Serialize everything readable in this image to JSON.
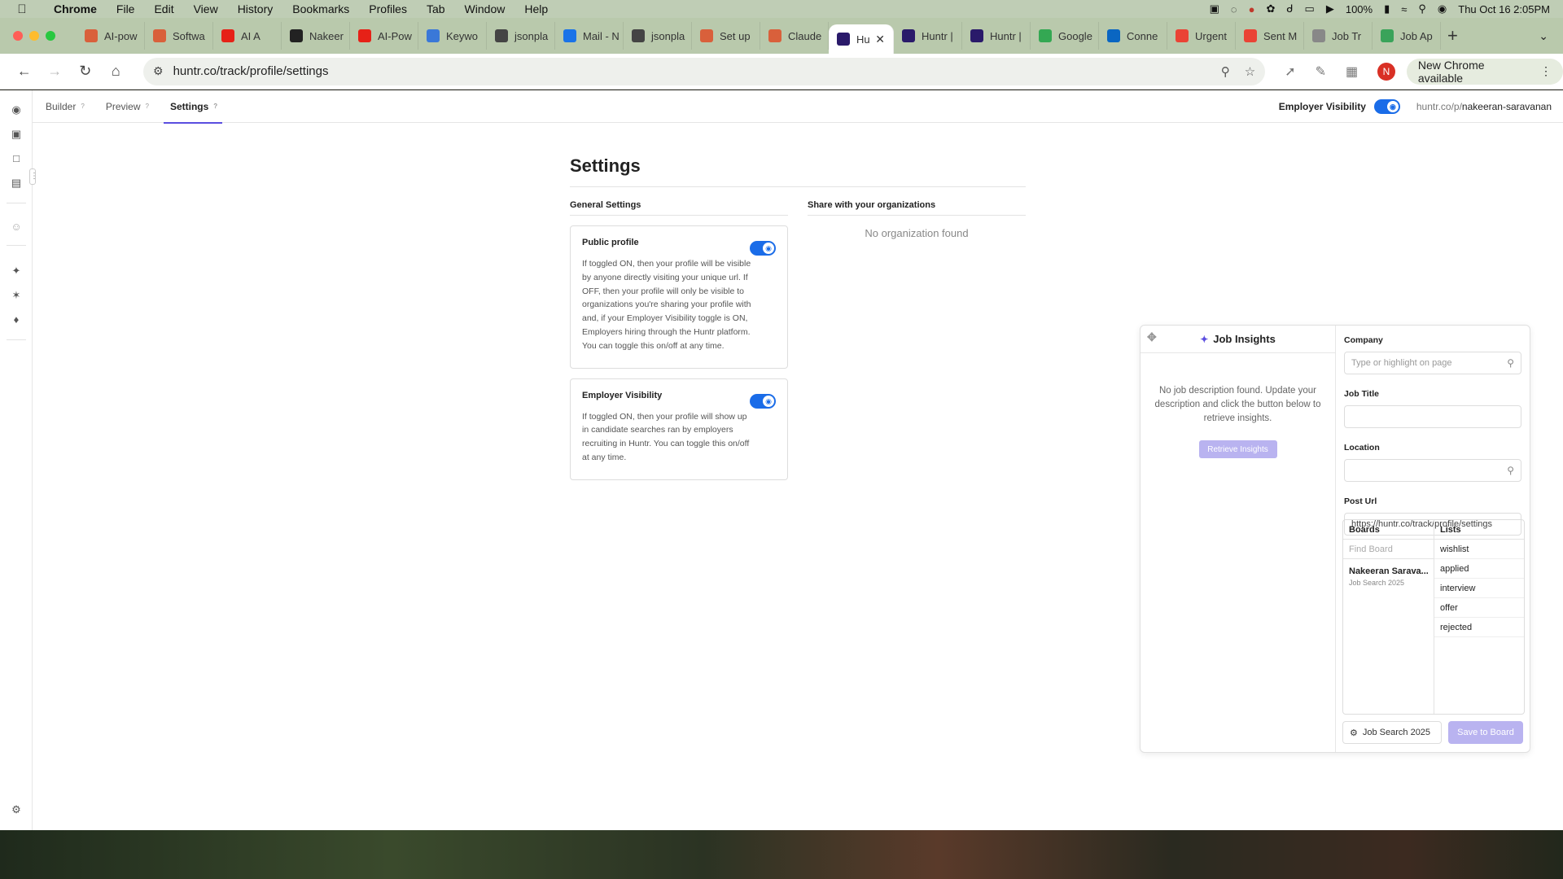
{
  "menubar": {
    "app": "Chrome",
    "items": [
      "File",
      "Edit",
      "View",
      "History",
      "Bookmarks",
      "Profiles",
      "Tab",
      "Window",
      "Help"
    ],
    "battery": "100%",
    "datetime": "Thu Oct 16  2:05PM"
  },
  "tabs": [
    {
      "label": "AI-pow",
      "icon": "claude-icon",
      "color": "#d9603b"
    },
    {
      "label": "Softwa",
      "icon": "claude-icon",
      "color": "#d9603b"
    },
    {
      "label": "AI A",
      "icon": "youtube-icon",
      "color": "#e62117"
    },
    {
      "label": "Nakeer",
      "icon": "github-icon",
      "color": "#222222"
    },
    {
      "label": "AI-Pow",
      "icon": "youtube-icon",
      "color": "#e62117"
    },
    {
      "label": "Keywo",
      "icon": "keyword-icon",
      "color": "#3a78d8"
    },
    {
      "label": "jsonpla",
      "icon": "jsonplaceholder-icon",
      "color": "#444444"
    },
    {
      "label": "Mail - N",
      "icon": "outlook-icon",
      "color": "#1a73e8"
    },
    {
      "label": "jsonpla",
      "icon": "jsonplaceholder-icon",
      "color": "#444444"
    },
    {
      "label": "Set up",
      "icon": "claude-icon",
      "color": "#d9603b"
    },
    {
      "label": "Claude",
      "icon": "claude-icon",
      "color": "#d9603b"
    },
    {
      "label": "Hu",
      "icon": "huntr-icon",
      "color": "#2a1a6a",
      "active": true
    },
    {
      "label": "Huntr |",
      "icon": "huntr-icon",
      "color": "#2a1a6a"
    },
    {
      "label": "Huntr |",
      "icon": "huntr-icon",
      "color": "#2a1a6a"
    },
    {
      "label": "Google",
      "icon": "maps-icon",
      "color": "#34a853"
    },
    {
      "label": "Conne",
      "icon": "linkedin-icon",
      "color": "#0a66c2"
    },
    {
      "label": "Urgent",
      "icon": "gmail-icon",
      "color": "#ea4335"
    },
    {
      "label": "Sent M",
      "icon": "gmail-icon",
      "color": "#ea4335"
    },
    {
      "label": "Job Tr",
      "icon": "globe-icon",
      "color": "#888888"
    },
    {
      "label": "Job Ap",
      "icon": "job-icon",
      "color": "#3aa35a"
    }
  ],
  "toolbar": {
    "url": "huntr.co/track/profile/settings",
    "new_chrome": "New Chrome available",
    "profile_initial": "N"
  },
  "subnav": {
    "tabs": [
      {
        "label": "Builder",
        "active": false
      },
      {
        "label": "Preview",
        "active": false
      },
      {
        "label": "Settings",
        "active": true
      }
    ],
    "help_glyph": "?",
    "employer_visibility_label": "Employer Visibility",
    "employer_visibility_on": true,
    "profile_url_prefix": "huntr.co/p/",
    "profile_url_slug": "nakeeran-saravanan"
  },
  "settings": {
    "title": "Settings",
    "general_title": "General Settings",
    "share_title": "Share with your organizations",
    "no_org": "No organization found",
    "public_profile": {
      "title": "Public profile",
      "on": true,
      "desc": "If toggled ON, then your profile will be visible by anyone directly visiting your unique url. If OFF, then your profile will only be visible to organizations you're sharing your profile with and, if your Employer Visibility toggle is ON, Employers hiring through the Huntr platform. You can toggle this on/off at any time."
    },
    "employer_visibility": {
      "title": "Employer Visibility",
      "on": true,
      "desc": "If toggled ON, then your profile will show up in candidate searches ran by employers recruiting in Huntr. You can toggle this on/off at any time."
    }
  },
  "job_insights": {
    "title": "Job Insights",
    "message": "No job description found. Update your description and click the button below to retrieve insights.",
    "retrieve_button": "Retrieve Insights",
    "company_label": "Company",
    "company_placeholder": "Type or highlight on page",
    "job_title_label": "Job Title",
    "job_title_value": "",
    "location_label": "Location",
    "location_value": "",
    "post_url_label": "Post Url",
    "post_url_value": "https://huntr.co/track/profile/settings",
    "boards_header": "Boards",
    "lists_header": "Lists",
    "find_board_placeholder": "Find Board",
    "board_name": "Nakeeran Sarava...",
    "board_sub": "Job Search 2025",
    "lists": [
      "wishlist",
      "applied",
      "interview",
      "offer",
      "rejected"
    ],
    "selected_board_pill": "Job Search 2025",
    "save_button": "Save to Board"
  },
  "colors": {
    "accent": "#5b4ee0",
    "toggle_on": "#1a6ce8",
    "disabled_button": "#b9b3f0"
  }
}
